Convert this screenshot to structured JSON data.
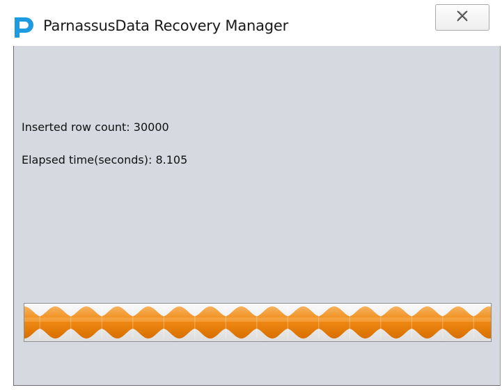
{
  "window": {
    "title": "ParnassusData Recovery Manager",
    "app_icon": "parnassus-p-logo-icon",
    "close_icon": "close-x-icon"
  },
  "status": {
    "rows_label": "Inserted row count: 30000",
    "time_label": "Elapsed time(seconds): 8.105"
  },
  "progress": {
    "state": "indeterminate",
    "color": "#f08a14"
  },
  "colors": {
    "content_bg": "#d6d9e0",
    "brand_blue": "#1e9be0",
    "progress_orange": "#f08a14"
  }
}
